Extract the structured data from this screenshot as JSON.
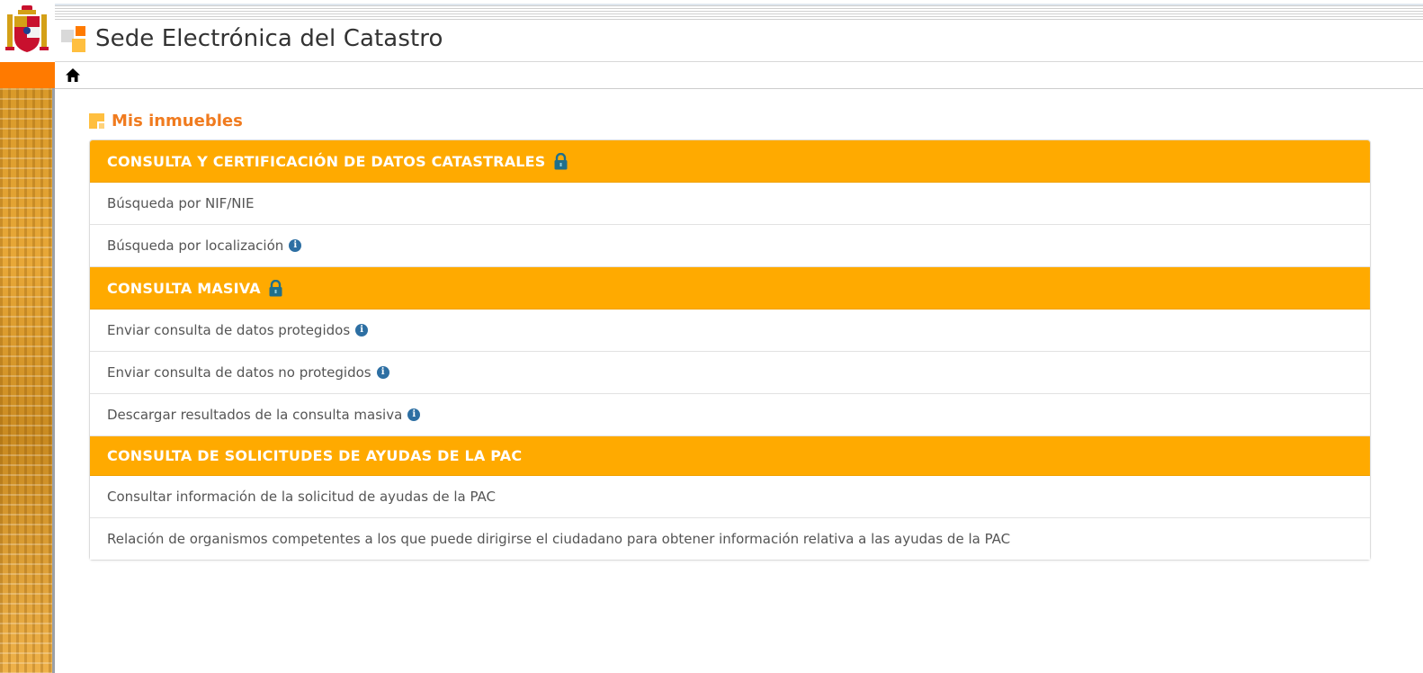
{
  "header": {
    "site_title": "Sede Electrónica del Catastro"
  },
  "nav": {
    "home_icon": "home-icon"
  },
  "section": {
    "title": "Mis inmuebles"
  },
  "groups": [
    {
      "title": "CONSULTA Y CERTIFICACIÓN DE DATOS CATASTRALES",
      "locked": true,
      "items": [
        {
          "label": "Búsqueda por NIF/NIE",
          "info": false
        },
        {
          "label": "Búsqueda por localización",
          "info": true
        }
      ]
    },
    {
      "title": "CONSULTA MASIVA",
      "locked": true,
      "items": [
        {
          "label": "Enviar consulta de datos protegidos",
          "info": true
        },
        {
          "label": "Enviar consulta de datos no protegidos",
          "info": true
        },
        {
          "label": "Descargar resultados de la consulta masiva",
          "info": true
        }
      ]
    },
    {
      "title": "CONSULTA DE SOLICITUDES DE AYUDAS DE LA PAC",
      "locked": false,
      "items": [
        {
          "label": "Consultar información de la solicitud de ayudas de la PAC",
          "info": false
        },
        {
          "label": "Relación de organismos competentes a los que puede dirigirse el ciudadano para obtener información relativa a las ayudas de la PAC",
          "info": false
        }
      ]
    }
  ],
  "colors": {
    "accent_orange": "#ff7a00",
    "group_header": "#ffaa00",
    "section_title": "#f07b1f",
    "info_icon": "#2d6fa3",
    "lock_icon": "#1f6f8b"
  },
  "icons": {
    "info": "info-icon",
    "lock": "lock-icon",
    "coat_of_arms": "coat-of-arms-icon",
    "logo": "catastro-logo-icon"
  }
}
